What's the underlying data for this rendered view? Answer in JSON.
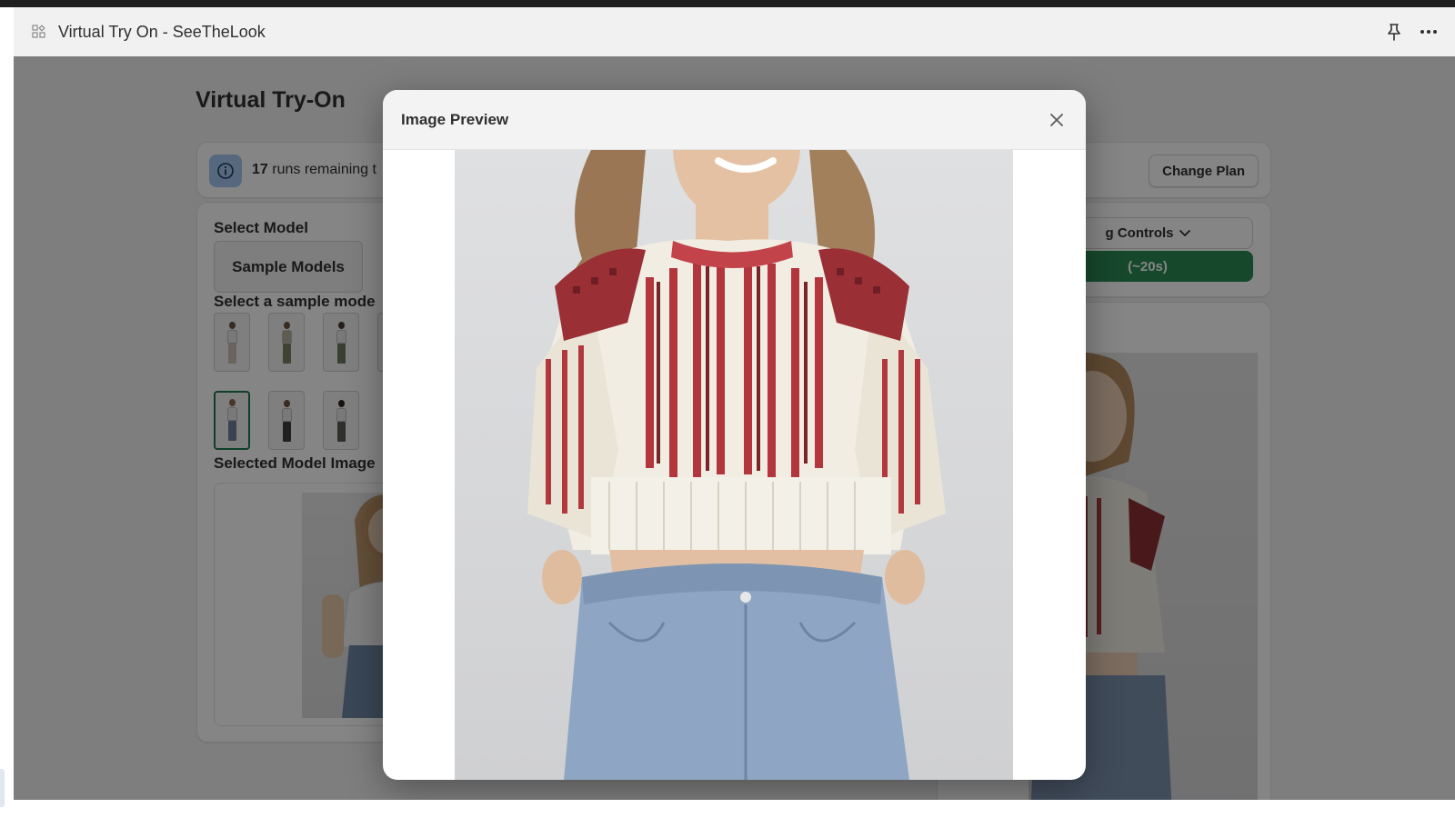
{
  "window": {
    "title": "Virtual Try On - SeeTheLook"
  },
  "page": {
    "title": "Virtual Try-On"
  },
  "banner": {
    "runs_count": "17",
    "runs_text": "runs remaining t",
    "change_plan_label": "Change Plan"
  },
  "model_panel": {
    "select_model_label": "Select Model",
    "sample_models_button": "Sample Models",
    "select_sample_label": "Select a sample mode",
    "selected_model_label": "Selected Model Image",
    "selected_thumbnail_index": 3
  },
  "controls": {
    "advanced_label": "g Controls",
    "generate_label": "(~20s)"
  },
  "modal": {
    "title": "Image Preview"
  },
  "colors": {
    "primary_green": "#2b8a55",
    "selected_border": "#1d7a4e",
    "info_badge": "#a4c8f0"
  },
  "icons": {
    "app": "app-grid-icon",
    "pin": "pin-icon",
    "more": "more-horizontal-icon",
    "info": "info-circle-icon",
    "chevron": "chevron-down-icon",
    "close": "close-icon"
  }
}
